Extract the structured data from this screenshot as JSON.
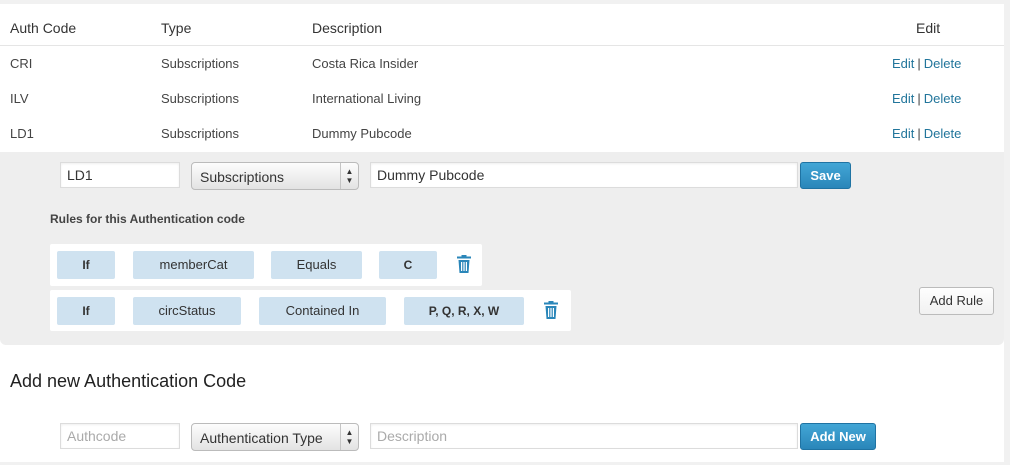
{
  "table": {
    "headers": {
      "code": "Auth Code",
      "type": "Type",
      "description": "Description",
      "edit": "Edit"
    },
    "rows": [
      {
        "code": "CRI",
        "type": "Subscriptions",
        "description": "Costa Rica Insider",
        "edit_label": "Edit",
        "separator": "|",
        "delete_label": "Delete"
      },
      {
        "code": "ILV",
        "type": "Subscriptions",
        "description": "International Living",
        "edit_label": "Edit",
        "separator": "|",
        "delete_label": "Delete"
      },
      {
        "code": "LD1",
        "type": "Subscriptions",
        "description": "Dummy Pubcode",
        "edit_label": "Edit",
        "separator": "|",
        "delete_label": "Delete"
      }
    ]
  },
  "editor": {
    "code_value": "LD1",
    "type_value": "Subscriptions",
    "description_value": "Dummy Pubcode",
    "save_label": "Save",
    "rules_title": "Rules for this Authentication code",
    "rules": [
      {
        "condition": "If",
        "field": "memberCat",
        "operator": "Equals",
        "value": "C"
      },
      {
        "condition": "If",
        "field": "circStatus",
        "operator": "Contained In",
        "value": "P, Q, R, X, W"
      }
    ],
    "add_rule_label": "Add Rule"
  },
  "add_new": {
    "title": "Add new Authentication Code",
    "code_placeholder": "Authcode",
    "type_value": "Authentication Type",
    "description_placeholder": "Description",
    "button_label": "Add New"
  },
  "colors": {
    "link": "#21759b",
    "primary_button": "#2a86b9",
    "rule_chip": "#cfe2f0",
    "editor_background": "#eeeeee"
  },
  "icons": {
    "rule_delete": "trash-icon",
    "select_arrows": "up-down-arrows-icon"
  }
}
